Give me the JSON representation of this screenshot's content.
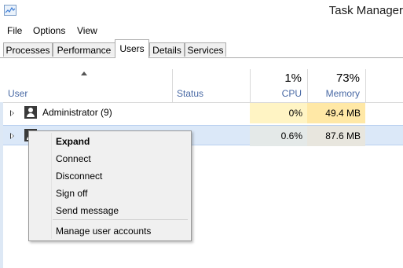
{
  "window": {
    "title": "Task Manager"
  },
  "menu": [
    "File",
    "Options",
    "View"
  ],
  "tabs": [
    "Processes",
    "Performance",
    "Users",
    "Details",
    "Services"
  ],
  "active_tab": "Users",
  "columns": {
    "user": "User",
    "status": "Status",
    "cpu": {
      "label": "CPU",
      "total": "1%"
    },
    "memory": {
      "label": "Memory",
      "total": "73%"
    }
  },
  "rows": [
    {
      "name": "Administrator (9)",
      "status": "",
      "cpu": "0%",
      "memory": "49.4 MB"
    },
    {
      "name": "",
      "status": "",
      "cpu": "0.6%",
      "memory": "87.6 MB"
    }
  ],
  "context_menu": {
    "items": [
      "Expand",
      "Connect",
      "Disconnect",
      "Sign off",
      "Send message"
    ],
    "footer": "Manage user accounts"
  },
  "colors": {
    "cpu_highlight": "#fff4c4",
    "memory_highlight": "#ffe8a6",
    "selected_row": "#dbe8f8",
    "header_label": "#4a6aa5"
  },
  "icons": [
    "task-manager-app-icon",
    "user-icon",
    "expand-arrow-icon",
    "sort-up-icon"
  ]
}
